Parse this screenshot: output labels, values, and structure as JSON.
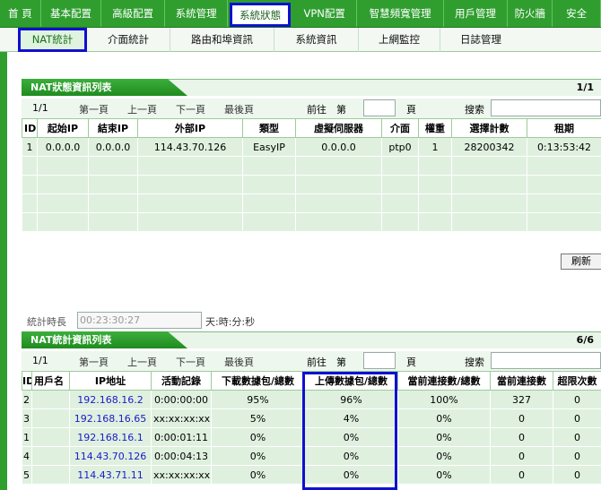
{
  "nav": {
    "tabs": [
      "首 頁",
      "基本配置",
      "高級配置",
      "系統管理",
      "系統狀態",
      "VPN配置",
      "智慧頻寬管理",
      "用戶管理",
      "防火牆",
      "安全"
    ],
    "active_index": 4
  },
  "subnav": {
    "tabs": [
      "NAT統計",
      "介面統計",
      "路由和埠資訊",
      "系統資訊",
      "上網監控",
      "日誌管理"
    ],
    "active_index": 0
  },
  "nat_status": {
    "title": "NAT狀態資訊列表",
    "count": "1/1",
    "pager": {
      "page": "1/1",
      "first": "第一頁",
      "prev": "上一頁",
      "next": "下一頁",
      "last": "最後頁",
      "goto_prefix": "前往",
      "goto_mid": "第",
      "goto_suffix": "頁",
      "search": "搜索",
      "goto_value": "",
      "search_value": ""
    },
    "columns": [
      "ID",
      "起始IP",
      "結束IP",
      "外部IP",
      "類型",
      "虛擬伺服器",
      "介面",
      "權重",
      "選擇計數",
      "租期"
    ],
    "rows": [
      [
        "1",
        "0.0.0.0",
        "0.0.0.0",
        "114.43.70.126",
        "EasyIP",
        "0.0.0.0",
        "ptp0",
        "1",
        "28200342",
        "0:13:53:42"
      ],
      [
        "",
        "",
        "",
        "",
        "",
        "",
        "",
        "",
        "",
        ""
      ],
      [
        "",
        "",
        "",
        "",
        "",
        "",
        "",
        "",
        "",
        ""
      ],
      [
        "",
        "",
        "",
        "",
        "",
        "",
        "",
        "",
        "",
        ""
      ],
      [
        "",
        "",
        "",
        "",
        "",
        "",
        "",
        "",
        "",
        ""
      ]
    ]
  },
  "refresh_label": "刷新",
  "timer": {
    "label": "統計時長",
    "value": "00:23:30:27",
    "unit": "天:時:分:秒"
  },
  "nat_stats": {
    "title": "NAT統計資訊列表",
    "count": "6/6",
    "pager": {
      "page": "1/1",
      "first": "第一頁",
      "prev": "上一頁",
      "next": "下一頁",
      "last": "最後頁",
      "goto_prefix": "前往",
      "goto_mid": "第",
      "goto_suffix": "頁",
      "search": "搜索",
      "goto_value": "",
      "search_value": ""
    },
    "columns": [
      "ID",
      "用戶名",
      "IP地址",
      "活動記錄",
      "下載數據包/總數",
      "上傳數據包/總數",
      "當前連接數/總數",
      "當前連接數",
      "超限次數"
    ],
    "rows": [
      [
        "2",
        "",
        "192.168.16.2",
        "0:00:00:00",
        "95%",
        "96%",
        "100%",
        "327",
        "0"
      ],
      [
        "3",
        "",
        "192.168.16.65",
        "xx:xx:xx:xx",
        "5%",
        "4%",
        "0%",
        "0",
        "0"
      ],
      [
        "1",
        "",
        "192.168.16.1",
        "0:00:01:11",
        "0%",
        "0%",
        "0%",
        "0",
        "0"
      ],
      [
        "4",
        "",
        "114.43.70.126",
        "0:00:04:13",
        "0%",
        "0%",
        "0%",
        "0",
        "0"
      ],
      [
        "5",
        "",
        "114.43.71.11",
        "xx:xx:xx:xx",
        "0%",
        "0%",
        "0%",
        "0",
        "0"
      ]
    ]
  },
  "colors": {
    "nav_green": "#2f9e2f",
    "highlight_blue": "#1010d0",
    "ip_link": "#1a1ac8",
    "row_bg": "#dff0df"
  }
}
